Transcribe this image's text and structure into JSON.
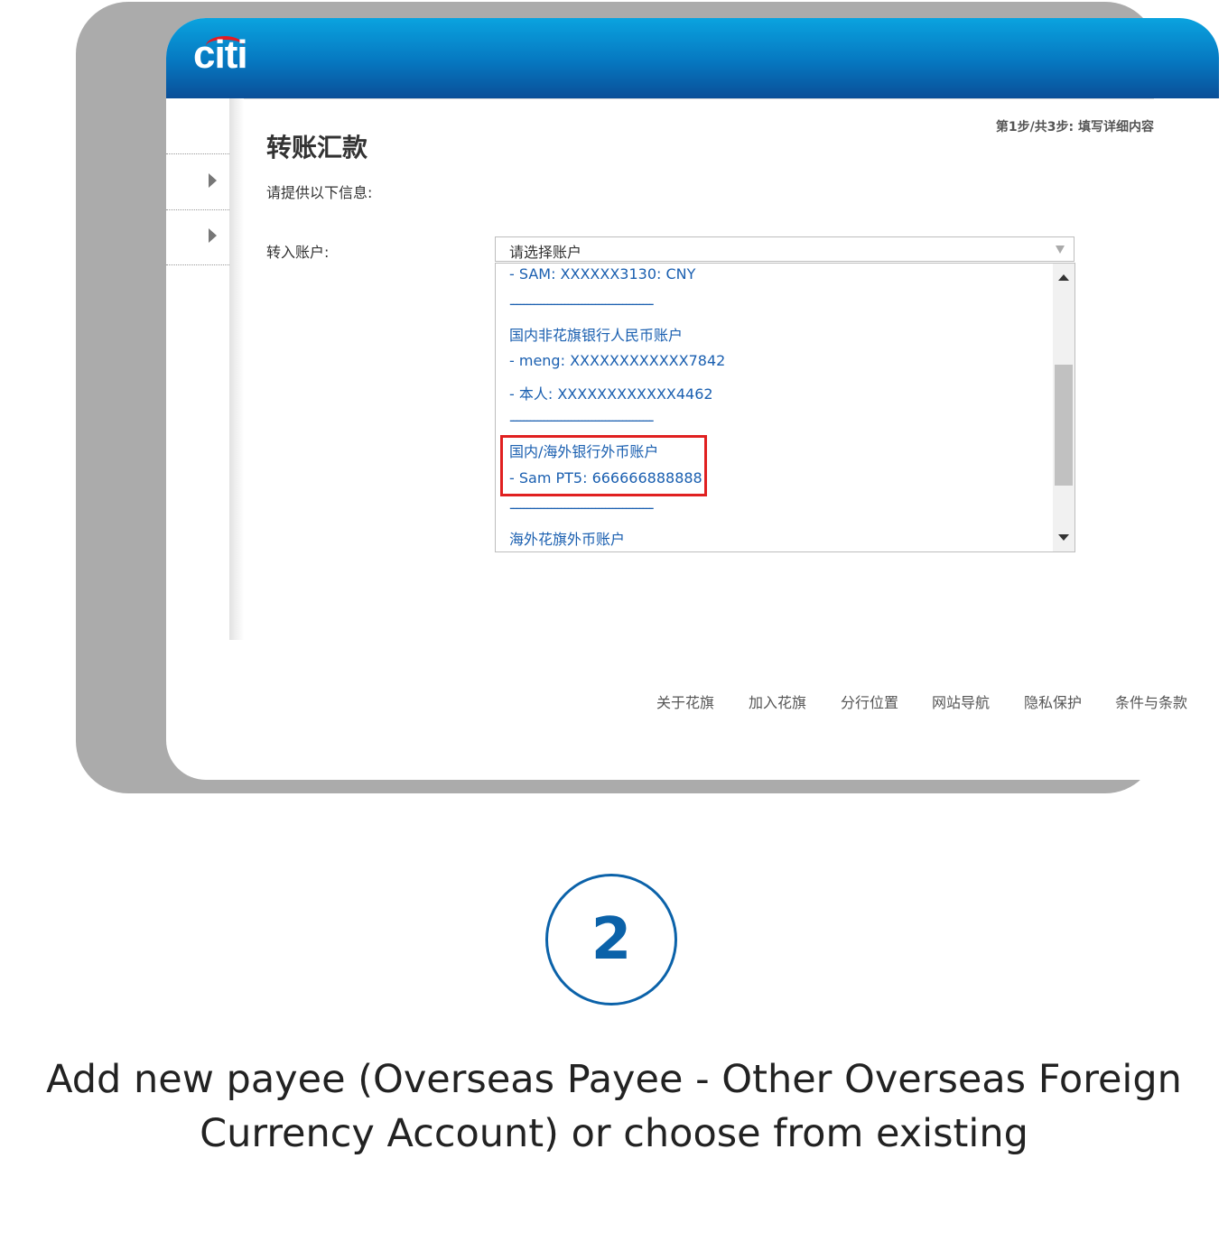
{
  "app": {
    "logo_text": "citi",
    "logo_arc_color": "#e31b23",
    "header_color": "#0677c0"
  },
  "page": {
    "title": "转账汇款",
    "step": "第1步/共3步: 填写详细内容",
    "prompt": "请提供以下信息:"
  },
  "form": {
    "to_account_label": "转入账户:",
    "select_value": "请选择账户",
    "options": [
      "- SAM: XXXXXX3130: CNY",
      "------------------------------------------",
      "国内非花旗银行人民币账户",
      "- meng: XXXXXXXXXXXX7842",
      "- 本人: XXXXXXXXXXXX4462",
      "------------------------------------------",
      "国内/海外银行外币账户",
      "- Sam PT5: 666666888888",
      "------------------------------------------",
      "海外花旗外币账户"
    ]
  },
  "footer": {
    "links": [
      "关于花旗",
      "加入花旗",
      "分行位置",
      "网站导航",
      "隐私保护",
      "条件与条款"
    ]
  },
  "guide": {
    "step_number": "2",
    "caption_line1": "Add new payee (Overseas Payee - Other Overseas Foreign",
    "caption_line2": "Currency Account) or choose from existing",
    "accent_color": "#0b62a9",
    "highlight_color": "#e02020"
  }
}
